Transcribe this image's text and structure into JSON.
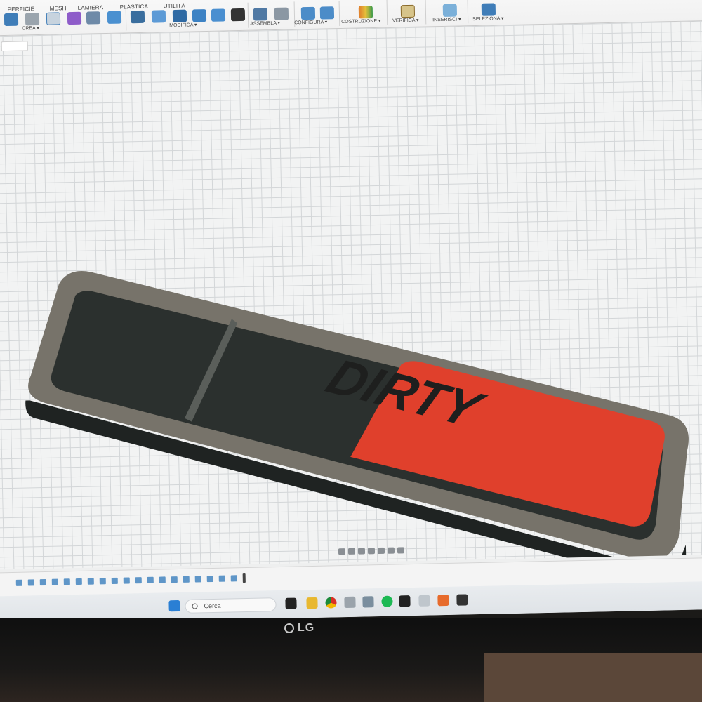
{
  "toolbar": {
    "tabs": [
      "PERFICIE",
      "MESH",
      "LAMIERA",
      "PLASTICA",
      "UTILITÀ"
    ],
    "groups": [
      "CREA ▾",
      "MODIFICA ▾",
      "ASSEMBLA ▾",
      "CONFIGURA ▾",
      "COSTRUZIONE ▾",
      "VERIFICA ▾",
      "INSERISCI ▾",
      "SELEZIONA ▾"
    ]
  },
  "model": {
    "label": "DIRTY",
    "accent_color": "#e0402c",
    "body_color": "#2a2e2c",
    "rim_color": "#7a766c"
  },
  "taskbar": {
    "search_placeholder": "Cerca"
  },
  "monitor": {
    "brand": "LG"
  },
  "icons": [
    "sketch-icon",
    "box-icon",
    "extrude-icon",
    "move-icon",
    "assemble-icon",
    "construct-icon",
    "measure-icon",
    "insert-image-icon",
    "select-icon",
    "windows-start-icon",
    "chrome-icon",
    "folder-icon",
    "spotify-icon"
  ]
}
